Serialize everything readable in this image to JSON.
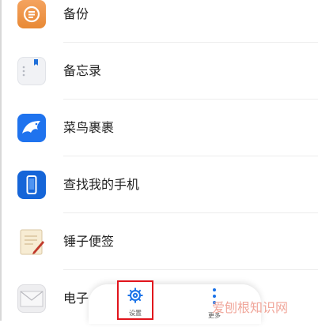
{
  "apps": [
    {
      "label": "备份",
      "icon": "backup-icon"
    },
    {
      "label": "备忘录",
      "icon": "memo-icon"
    },
    {
      "label": "菜鸟裹裹",
      "icon": "cainiao-icon"
    },
    {
      "label": "查找我的手机",
      "icon": "find-phone-icon"
    },
    {
      "label": "锤子便签",
      "icon": "smartisan-notes-icon"
    },
    {
      "label": "电子",
      "icon": "mail-icon"
    }
  ],
  "toolbar": {
    "settings_label": "设置",
    "more_label": "更多",
    "highlight_color": "#e1141c"
  },
  "watermark": "爱刨根知识网"
}
